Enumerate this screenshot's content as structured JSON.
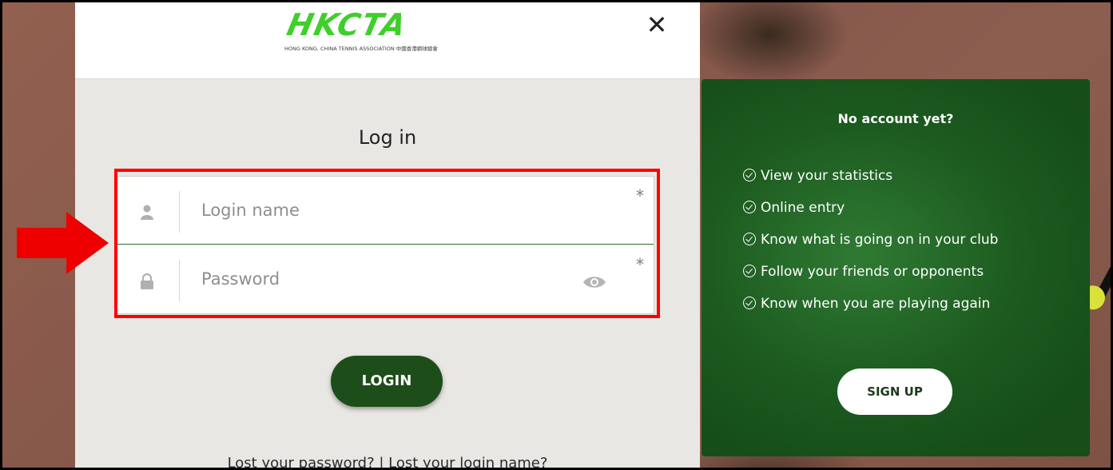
{
  "brand": {
    "logo_text": "HKCTA",
    "subtitle": "HONG KONG, CHINA TENNIS ASSOCIATION 中國香港網球總會",
    "accent_color": "#3fcf2a"
  },
  "modal": {
    "close_label": "✕",
    "title": "Log in"
  },
  "form": {
    "login_name": {
      "placeholder": "Login name",
      "required_mark": "*",
      "icon": "user-icon"
    },
    "password": {
      "placeholder": "Password",
      "required_mark": "*",
      "icon": "lock-icon",
      "toggle_icon": "eye-icon"
    },
    "login_button": "LOGIN",
    "lost_password": "Lost your password?",
    "separator": " | ",
    "lost_login": "Lost your login name?"
  },
  "signup": {
    "title": "No account yet?",
    "benefits": [
      "View your statistics",
      "Online entry",
      "Know what is going on in your club",
      "Follow your friends or opponents",
      "Know when you are playing again"
    ],
    "button": "SIGN UP"
  },
  "annotations": {
    "highlight_color": "#ff0000",
    "arrow_color": "#ee0000"
  }
}
